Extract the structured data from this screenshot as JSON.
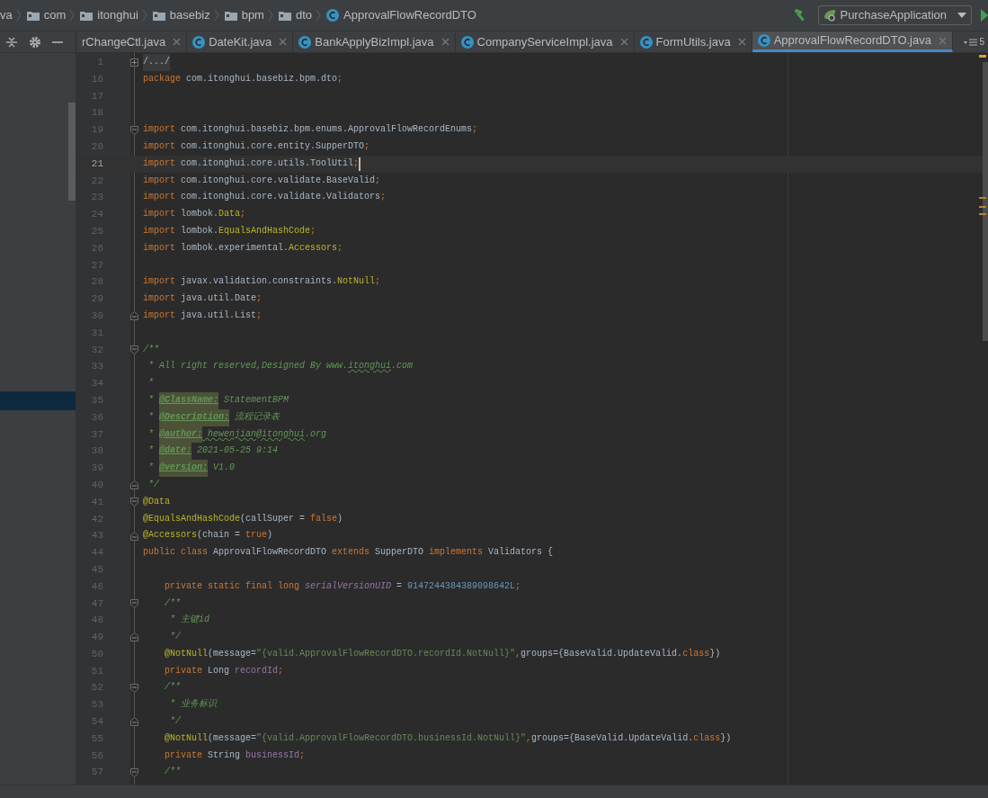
{
  "breadcrumbs": [
    {
      "kind": "text",
      "label": "va"
    },
    {
      "kind": "folder",
      "label": "com"
    },
    {
      "kind": "folder",
      "label": "itonghui"
    },
    {
      "kind": "folder",
      "label": "basebiz"
    },
    {
      "kind": "folder",
      "label": "bpm"
    },
    {
      "kind": "folder",
      "label": "dto"
    },
    {
      "kind": "class",
      "label": "ApprovalFlowRecordDTO"
    }
  ],
  "run_configuration": "PurchaseApplication",
  "tabs": [
    {
      "label": "rChangeCtl.java",
      "icon": false,
      "selected": false
    },
    {
      "label": "DateKit.java",
      "icon": true,
      "selected": false
    },
    {
      "label": "BankApplyBizImpl.java",
      "icon": true,
      "selected": false
    },
    {
      "label": "CompanyServiceImpl.java",
      "icon": true,
      "selected": false
    },
    {
      "label": "FormUtils.java",
      "icon": true,
      "selected": false
    },
    {
      "label": "ApprovalFlowRecordDTO.java",
      "icon": true,
      "selected": true
    }
  ],
  "hidden_tabs_count": "5",
  "lines": [
    {
      "number": "1",
      "current": false,
      "collapsed": true,
      "fold_start": false,
      "fold_end": false,
      "tokens": [
        {
          "kind": "folded",
          "text": "/.../"
        }
      ]
    },
    {
      "number": "16",
      "current": false,
      "collapsed": false,
      "fold_start": false,
      "fold_end": false,
      "tokens": [
        {
          "kind": "kw",
          "text": "package"
        },
        {
          "kind": "plain",
          "text": " com.itonghui.basebiz.bpm.dto"
        },
        {
          "kind": "kw",
          "text": ";"
        }
      ]
    },
    {
      "number": "17",
      "current": false,
      "collapsed": false,
      "fold_start": false,
      "fold_end": false
    },
    {
      "number": "18",
      "current": false,
      "collapsed": false,
      "fold_start": false,
      "fold_end": false
    },
    {
      "number": "19",
      "current": false,
      "collapsed": false,
      "fold_start": true,
      "fold_end": false,
      "tokens": [
        {
          "kind": "kw",
          "text": "import"
        },
        {
          "kind": "plain",
          "text": " com.itonghui.basebiz.bpm.enums.ApprovalFlowRecordEnums"
        },
        {
          "kind": "kw",
          "text": ";"
        }
      ]
    },
    {
      "number": "20",
      "current": false,
      "collapsed": false,
      "fold_start": false,
      "fold_end": false,
      "tokens": [
        {
          "kind": "kw",
          "text": "import"
        },
        {
          "kind": "plain",
          "text": " com.itonghui.core.entity.SupperDTO"
        },
        {
          "kind": "kw",
          "text": ";"
        }
      ]
    },
    {
      "number": "21",
      "current": true,
      "collapsed": false,
      "fold_start": false,
      "fold_end": false,
      "tokens": [
        {
          "kind": "kw",
          "text": "import"
        },
        {
          "kind": "plain",
          "text": " com.itonghui.core.utils.ToolUtil"
        },
        {
          "kind": "kw",
          "text": ";"
        }
      ]
    },
    {
      "number": "22",
      "current": false,
      "collapsed": false,
      "fold_start": false,
      "fold_end": false,
      "tokens": [
        {
          "kind": "kw",
          "text": "import"
        },
        {
          "kind": "plain",
          "text": " com.itonghui.core.validate.BaseValid"
        },
        {
          "kind": "kw",
          "text": ";"
        }
      ]
    },
    {
      "number": "23",
      "current": false,
      "collapsed": false,
      "fold_start": false,
      "fold_end": false,
      "tokens": [
        {
          "kind": "kw",
          "text": "import"
        },
        {
          "kind": "plain",
          "text": " com.itonghui.core.validate.Validators"
        },
        {
          "kind": "kw",
          "text": ";"
        }
      ]
    },
    {
      "number": "24",
      "current": false,
      "collapsed": false,
      "fold_start": false,
      "fold_end": false,
      "tokens": [
        {
          "kind": "kw",
          "text": "import"
        },
        {
          "kind": "plain",
          "text": " lombok."
        },
        {
          "kind": "ann",
          "text": "Data"
        },
        {
          "kind": "kw",
          "text": ";"
        }
      ]
    },
    {
      "number": "25",
      "current": false,
      "collapsed": false,
      "fold_start": false,
      "fold_end": false,
      "tokens": [
        {
          "kind": "kw",
          "text": "import"
        },
        {
          "kind": "plain",
          "text": " lombok."
        },
        {
          "kind": "ann",
          "text": "EqualsAndHashCode"
        },
        {
          "kind": "kw",
          "text": ";"
        }
      ]
    },
    {
      "number": "26",
      "current": false,
      "collapsed": false,
      "fold_start": false,
      "fold_end": false,
      "tokens": [
        {
          "kind": "kw",
          "text": "import"
        },
        {
          "kind": "plain",
          "text": " lombok.experimental."
        },
        {
          "kind": "ann",
          "text": "Accessors"
        },
        {
          "kind": "kw",
          "text": ";"
        }
      ]
    },
    {
      "number": "27",
      "current": false,
      "collapsed": false,
      "fold_start": false,
      "fold_end": false
    },
    {
      "number": "28",
      "current": false,
      "collapsed": false,
      "fold_start": false,
      "fold_end": false,
      "tokens": [
        {
          "kind": "kw",
          "text": "import"
        },
        {
          "kind": "plain",
          "text": " javax.validation.constraints."
        },
        {
          "kind": "ann",
          "text": "NotNull"
        },
        {
          "kind": "kw",
          "text": ";"
        }
      ]
    },
    {
      "number": "29",
      "current": false,
      "collapsed": false,
      "fold_start": false,
      "fold_end": false,
      "tokens": [
        {
          "kind": "kw",
          "text": "import"
        },
        {
          "kind": "plain",
          "text": " java.util.Date"
        },
        {
          "kind": "kw",
          "text": ";"
        }
      ]
    },
    {
      "number": "30",
      "current": false,
      "collapsed": false,
      "fold_start": false,
      "fold_end": true,
      "tokens": [
        {
          "kind": "kw",
          "text": "import"
        },
        {
          "kind": "plain",
          "text": " java.util.List"
        },
        {
          "kind": "kw",
          "text": ";"
        }
      ]
    },
    {
      "number": "31",
      "current": false,
      "collapsed": false,
      "fold_start": false,
      "fold_end": false
    },
    {
      "number": "32",
      "current": false,
      "collapsed": false,
      "fold_start": true,
      "fold_end": false,
      "tokens": [
        {
          "kind": "cmt",
          "text": "/**"
        }
      ]
    },
    {
      "number": "33",
      "current": false,
      "collapsed": false,
      "fold_start": false,
      "fold_end": false,
      "tokens": [
        {
          "kind": "cmt",
          "text": " * All right reserved,Designed By www."
        },
        {
          "kind": "wavy",
          "text": "itonghui"
        },
        {
          "kind": "cmt",
          "text": ".com"
        }
      ]
    },
    {
      "number": "34",
      "current": false,
      "collapsed": false,
      "fold_start": false,
      "fold_end": false,
      "tokens": [
        {
          "kind": "cmt",
          "text": " *"
        }
      ]
    },
    {
      "number": "35",
      "current": false,
      "collapsed": false,
      "fold_start": false,
      "fold_end": false,
      "tokens": [
        {
          "kind": "cmt",
          "text": " * "
        },
        {
          "kind": "tag",
          "text": "@ClassName:"
        },
        {
          "kind": "cmt",
          "text": " StatementBPM"
        }
      ]
    },
    {
      "number": "36",
      "current": false,
      "collapsed": false,
      "fold_start": false,
      "fold_end": false,
      "tokens": [
        {
          "kind": "cmt",
          "text": " * "
        },
        {
          "kind": "tag",
          "text": "@Description:"
        },
        {
          "kind": "cmt",
          "text": " 流程记录表"
        }
      ]
    },
    {
      "number": "37",
      "current": false,
      "collapsed": false,
      "fold_start": false,
      "fold_end": false,
      "tokens": [
        {
          "kind": "cmt",
          "text": " * "
        },
        {
          "kind": "tag",
          "text": "@author:"
        },
        {
          "kind": "wavy",
          "text": " hewenjian@itonghui"
        },
        {
          "kind": "cmt",
          "text": ".org"
        }
      ]
    },
    {
      "number": "38",
      "current": false,
      "collapsed": false,
      "fold_start": false,
      "fold_end": false,
      "tokens": [
        {
          "kind": "cmt",
          "text": " * "
        },
        {
          "kind": "tag",
          "text": "@date:"
        },
        {
          "kind": "cmt",
          "text": " 2021-05-25 9:14"
        }
      ]
    },
    {
      "number": "39",
      "current": false,
      "collapsed": false,
      "fold_start": false,
      "fold_end": false,
      "tokens": [
        {
          "kind": "cmt",
          "text": " * "
        },
        {
          "kind": "tag",
          "text": "@version:"
        },
        {
          "kind": "cmt",
          "text": " V1.0"
        }
      ]
    },
    {
      "number": "40",
      "current": false,
      "collapsed": false,
      "fold_start": false,
      "fold_end": true,
      "tokens": [
        {
          "kind": "cmt",
          "text": " */"
        }
      ]
    },
    {
      "number": "41",
      "current": false,
      "collapsed": false,
      "fold_start": true,
      "fold_end": false,
      "tokens": [
        {
          "kind": "ann",
          "text": "@Data"
        }
      ]
    },
    {
      "number": "42",
      "current": false,
      "collapsed": false,
      "fold_start": false,
      "fold_end": false,
      "tokens": [
        {
          "kind": "ann",
          "text": "@EqualsAndHashCode"
        },
        {
          "kind": "plain",
          "text": "(callSuper = "
        },
        {
          "kind": "kw",
          "text": "false"
        },
        {
          "kind": "plain",
          "text": ")"
        }
      ]
    },
    {
      "number": "43",
      "current": false,
      "collapsed": false,
      "fold_start": false,
      "fold_end": true,
      "tokens": [
        {
          "kind": "ann",
          "text": "@Accessors"
        },
        {
          "kind": "plain",
          "text": "(chain = "
        },
        {
          "kind": "kw",
          "text": "true"
        },
        {
          "kind": "plain",
          "text": ")"
        }
      ]
    },
    {
      "number": "44",
      "current": false,
      "collapsed": false,
      "fold_start": false,
      "fold_end": false,
      "tokens": [
        {
          "kind": "kw",
          "text": "public class "
        },
        {
          "kind": "plain",
          "text": "ApprovalFlowRecordDTO "
        },
        {
          "kind": "kw",
          "text": "extends "
        },
        {
          "kind": "plain",
          "text": "SupperDTO "
        },
        {
          "kind": "kw",
          "text": "implements "
        },
        {
          "kind": "plain",
          "text": "Validators {"
        }
      ]
    },
    {
      "number": "45",
      "current": false,
      "collapsed": false,
      "fold_start": false,
      "fold_end": false
    },
    {
      "number": "46",
      "current": false,
      "collapsed": false,
      "fold_start": false,
      "fold_end": false,
      "tokens": [
        {
          "kind": "kw",
          "text": "    private static final long "
        },
        {
          "kind": "sfield",
          "text": "serialVersionUID"
        },
        {
          "kind": "plain",
          "text": " = "
        },
        {
          "kind": "num",
          "text": "9147244384389098642L"
        },
        {
          "kind": "kw",
          "text": ";"
        }
      ]
    },
    {
      "number": "47",
      "current": false,
      "collapsed": false,
      "fold_start": true,
      "fold_end": false,
      "tokens": [
        {
          "kind": "cmt",
          "text": "    /**"
        }
      ]
    },
    {
      "number": "48",
      "current": false,
      "collapsed": false,
      "fold_start": false,
      "fold_end": false,
      "tokens": [
        {
          "kind": "cmt",
          "text": "     * 主键id"
        }
      ]
    },
    {
      "number": "49",
      "current": false,
      "collapsed": false,
      "fold_start": false,
      "fold_end": true,
      "tokens": [
        {
          "kind": "cmt",
          "text": "     */"
        }
      ]
    },
    {
      "number": "50",
      "current": false,
      "collapsed": false,
      "fold_start": false,
      "fold_end": false,
      "tokens": [
        {
          "kind": "ann",
          "text": "    @NotNull"
        },
        {
          "kind": "plain",
          "text": "(message="
        },
        {
          "kind": "str",
          "text": "\"{valid.ApprovalFlowRecordDTO.recordId.NotNull}\""
        },
        {
          "kind": "kw",
          "text": ","
        },
        {
          "kind": "plain",
          "text": "groups={BaseValid.UpdateValid."
        },
        {
          "kind": "kw",
          "text": "class"
        },
        {
          "kind": "plain",
          "text": "})"
        }
      ]
    },
    {
      "number": "51",
      "current": false,
      "collapsed": false,
      "fold_start": false,
      "fold_end": false,
      "tokens": [
        {
          "kind": "kw",
          "text": "    private "
        },
        {
          "kind": "plain",
          "text": "Long "
        },
        {
          "kind": "field",
          "text": "recordId"
        },
        {
          "kind": "kw",
          "text": ";"
        }
      ]
    },
    {
      "number": "52",
      "current": false,
      "collapsed": false,
      "fold_start": true,
      "fold_end": false,
      "tokens": [
        {
          "kind": "cmt",
          "text": "    /**"
        }
      ]
    },
    {
      "number": "53",
      "current": false,
      "collapsed": false,
      "fold_start": false,
      "fold_end": false,
      "tokens": [
        {
          "kind": "cmt",
          "text": "     * 业务标识"
        }
      ]
    },
    {
      "number": "54",
      "current": false,
      "collapsed": false,
      "fold_start": false,
      "fold_end": true,
      "tokens": [
        {
          "kind": "cmt",
          "text": "     */"
        }
      ]
    },
    {
      "number": "55",
      "current": false,
      "collapsed": false,
      "fold_start": false,
      "fold_end": false,
      "tokens": [
        {
          "kind": "ann",
          "text": "    @NotNull"
        },
        {
          "kind": "plain",
          "text": "(message="
        },
        {
          "kind": "str",
          "text": "\"{valid.ApprovalFlowRecordDTO.businessId.NotNull}\""
        },
        {
          "kind": "kw",
          "text": ","
        },
        {
          "kind": "plain",
          "text": "groups={BaseValid.UpdateValid."
        },
        {
          "kind": "kw",
          "text": "class"
        },
        {
          "kind": "plain",
          "text": "})"
        }
      ]
    },
    {
      "number": "56",
      "current": false,
      "collapsed": false,
      "fold_start": false,
      "fold_end": false,
      "tokens": [
        {
          "kind": "kw",
          "text": "    private "
        },
        {
          "kind": "plain",
          "text": "String "
        },
        {
          "kind": "field",
          "text": "businessId"
        },
        {
          "kind": "kw",
          "text": ";"
        }
      ]
    },
    {
      "number": "57",
      "current": false,
      "collapsed": false,
      "fold_start": true,
      "fold_end": false,
      "tokens": [
        {
          "kind": "cmt",
          "text": "    /**"
        }
      ]
    }
  ]
}
